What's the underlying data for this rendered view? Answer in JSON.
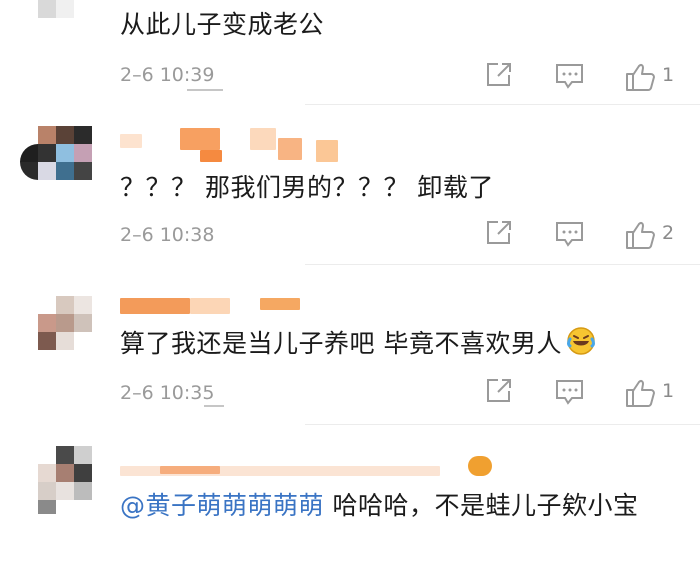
{
  "comments": [
    {
      "text": "从此儿子变成老公",
      "time": "2–6 10:39",
      "likes": "1",
      "icons": [
        "share-icon",
        "comment-icon",
        "thumbs-up-icon"
      ]
    },
    {
      "text": "？？？ 那我们男的？？？ 卸载了",
      "time": "2–6 10:38",
      "likes": "2",
      "icons": [
        "share-icon",
        "comment-icon",
        "thumbs-up-icon"
      ]
    },
    {
      "text": "算了我还是当儿子养吧 毕竟不喜欢男人",
      "time": "2–6 10:35",
      "likes": "1",
      "icons": [
        "share-icon",
        "comment-icon",
        "thumbs-up-icon",
        "laughing-crying-emoji"
      ]
    },
    {
      "mention": "@黄子萌萌萌萌萌",
      "text": " 哈哈哈，不是蛙儿子欸小宝"
    }
  ],
  "colors": {
    "mention": "#3a74c4",
    "meta_text": "#9a9a9a",
    "separator": "#ececec",
    "username_blur": "#f39b5a"
  }
}
